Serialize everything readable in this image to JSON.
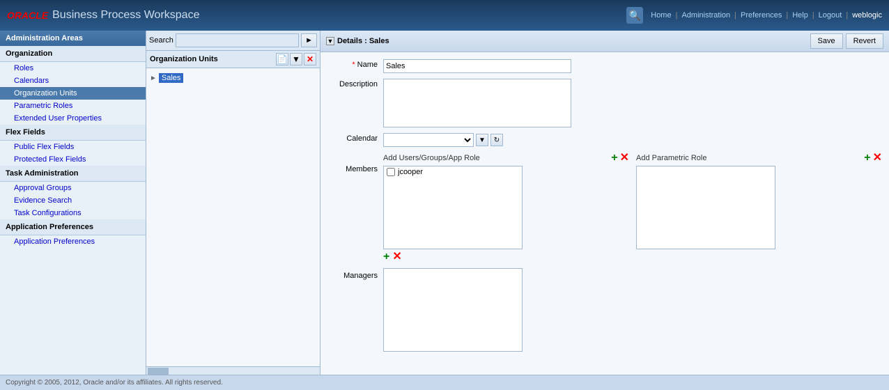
{
  "header": {
    "oracle_label": "ORACLE",
    "app_title": "Business Process Workspace",
    "nav": {
      "home": "Home",
      "administration": "Administration",
      "preferences": "Preferences",
      "help": "Help",
      "logout": "Logout",
      "user": "weblogic"
    }
  },
  "sidebar": {
    "title": "Administration Areas",
    "sections": [
      {
        "id": "organization",
        "title": "Organization",
        "items": [
          {
            "id": "roles",
            "label": "Roles",
            "active": false
          },
          {
            "id": "calendars",
            "label": "Calendars",
            "active": false
          },
          {
            "id": "organization-units",
            "label": "Organization Units",
            "active": true
          },
          {
            "id": "parametric-roles",
            "label": "Parametric Roles",
            "active": false
          },
          {
            "id": "extended-user-properties",
            "label": "Extended User Properties",
            "active": false
          }
        ]
      },
      {
        "id": "flex-fields",
        "title": "Flex Fields",
        "items": [
          {
            "id": "public-flex-fields",
            "label": "Public Flex Fields",
            "active": false
          },
          {
            "id": "protected-flex-fields",
            "label": "Protected Flex Fields",
            "active": false
          }
        ]
      },
      {
        "id": "task-administration",
        "title": "Task Administration",
        "items": [
          {
            "id": "approval-groups",
            "label": "Approval Groups",
            "active": false
          },
          {
            "id": "evidence-search",
            "label": "Evidence Search",
            "active": false
          },
          {
            "id": "task-configurations",
            "label": "Task Configurations",
            "active": false
          }
        ]
      },
      {
        "id": "application-preferences",
        "title": "Application Preferences",
        "items": [
          {
            "id": "app-preferences",
            "label": "Application Preferences",
            "active": false
          }
        ]
      }
    ]
  },
  "middle": {
    "search_placeholder": "Search",
    "panel_title": "Organization Units",
    "tree_item": "Sales"
  },
  "details": {
    "title": "Details : Sales",
    "save_label": "Save",
    "revert_label": "Revert",
    "name_label": "Name",
    "name_value": "Sales",
    "description_label": "Description",
    "calendar_label": "Calendar",
    "add_users_label": "Add Users/Groups/App Role",
    "add_parametric_label": "Add Parametric Role",
    "members_label": "Members",
    "managers_label": "Managers",
    "member_item": "jcooper"
  },
  "footer": {
    "copyright": "Copyright © 2005, 2012, Oracle and/or its affiliates. All rights reserved."
  }
}
